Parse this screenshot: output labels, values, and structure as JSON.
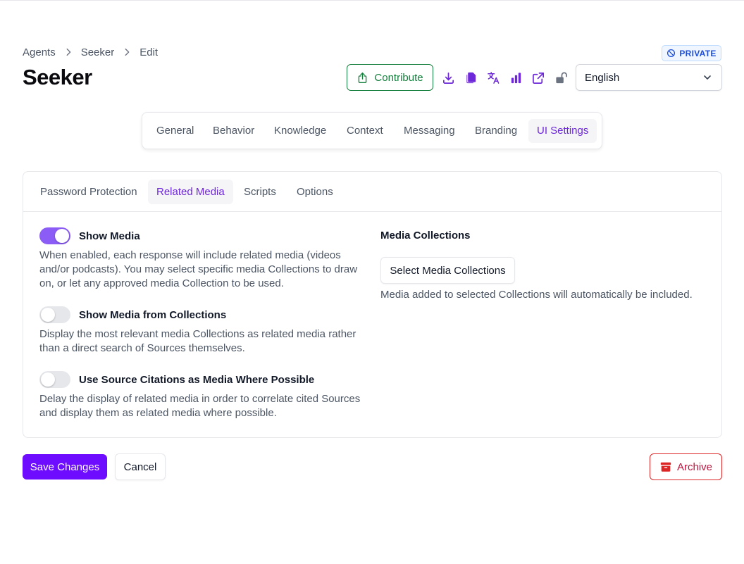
{
  "breadcrumb": {
    "items": [
      "Agents",
      "Seeker",
      "Edit"
    ]
  },
  "page": {
    "title": "Seeker",
    "visibility_badge": "PRIVATE"
  },
  "toolbar": {
    "contribute_label": "Contribute",
    "icons": [
      "download-icon",
      "copy-icon",
      "translate-icon",
      "analytics-icon",
      "external-link-icon",
      "unlock-icon"
    ],
    "language": "English"
  },
  "colors": {
    "accent": "#6d0cff",
    "toggle_on": "#8b5cf6",
    "success": "#15803d",
    "danger": "#dc2626",
    "badge": "#1d4ed8"
  },
  "tabs": {
    "items": [
      "General",
      "Behavior",
      "Knowledge",
      "Context",
      "Messaging",
      "Branding",
      "UI Settings"
    ],
    "active": "UI Settings"
  },
  "subtabs": {
    "items": [
      "Password Protection",
      "Related Media",
      "Scripts",
      "Options"
    ],
    "active": "Related Media"
  },
  "options": [
    {
      "label": "Show Media",
      "enabled": true,
      "description": "When enabled, each response will include related media (videos and/or podcasts). You may select specific media Collections to draw on, or let any approved media Collection to be used."
    },
    {
      "label": "Show Media from Collections",
      "enabled": false,
      "description": "Display the most relevant media Collections as related media rather than a direct search of Sources themselves."
    },
    {
      "label": "Use Source Citations as Media Where Possible",
      "enabled": false,
      "description": "Delay the display of related media in order to correlate cited Sources and display them as related media where possible."
    }
  ],
  "media_collections": {
    "label": "Media Collections",
    "button_label": "Select Media Collections",
    "help": "Media added to selected Collections will automatically be included."
  },
  "actions": {
    "save_label": "Save Changes",
    "cancel_label": "Cancel",
    "archive_label": "Archive"
  }
}
